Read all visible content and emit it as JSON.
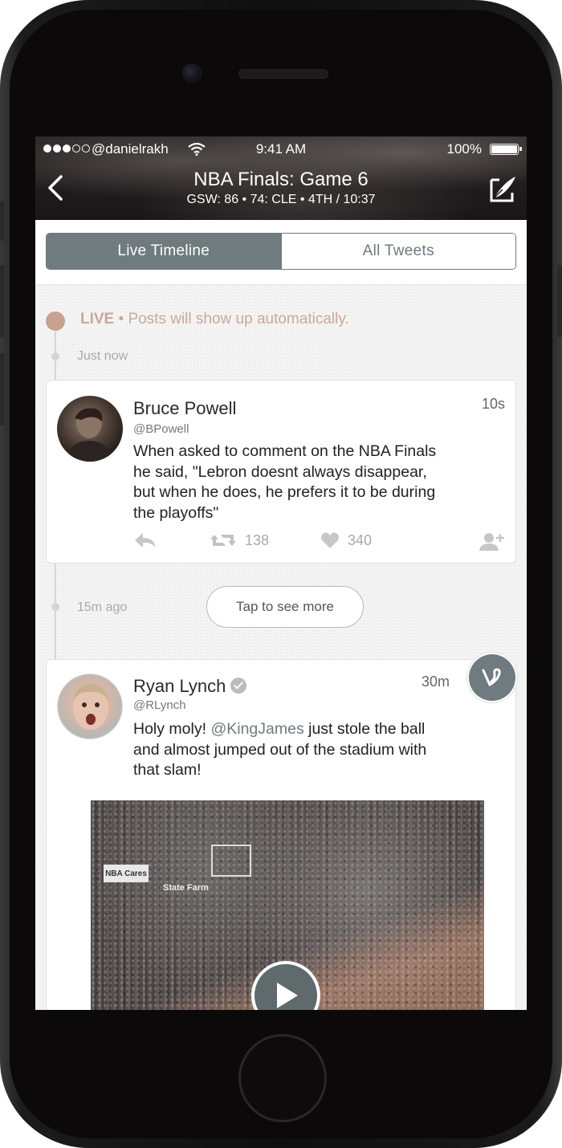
{
  "status_bar": {
    "carrier": "@danielrakh",
    "time": "9:41 AM",
    "battery": "100%"
  },
  "header": {
    "title": "NBA Finals: Game 6",
    "subtitle": "GSW: 86 • 74: CLE • 4TH / 10:37"
  },
  "tabs": [
    {
      "label": "Live Timeline",
      "active": true
    },
    {
      "label": "All Tweets",
      "active": false
    }
  ],
  "live_banner": {
    "label": "LIVE",
    "text": " • Posts will show up automatically."
  },
  "timeline": {
    "just_now": "Just now",
    "fifteen_ago": "15m ago",
    "tap_more": "Tap to see more"
  },
  "tweets": [
    {
      "name": "Bruce Powell",
      "handle": "@BPowell",
      "time": "10s",
      "text_lines": [
        "When asked to comment on the NBA Finals",
        "he said, \"Lebron doesnt always disappear,",
        "but when he does, he prefers it to be during",
        "the playoffs\""
      ],
      "retweets": "138",
      "likes": "340"
    },
    {
      "name": "Ryan Lynch",
      "handle": "@RLynch",
      "time": "30m",
      "text_prefix": "Holy moly! ",
      "mention": "@KingJames",
      "text_suffix": " just stole the ball",
      "text_lines_rest": [
        "and almost jumped out of the stadium with",
        "that slam!"
      ],
      "video_sign": "NBA Cares",
      "video_sign2": "State Farm"
    }
  ],
  "colors": {
    "accent": "#6f7b7e",
    "live": "#c8a18f"
  }
}
